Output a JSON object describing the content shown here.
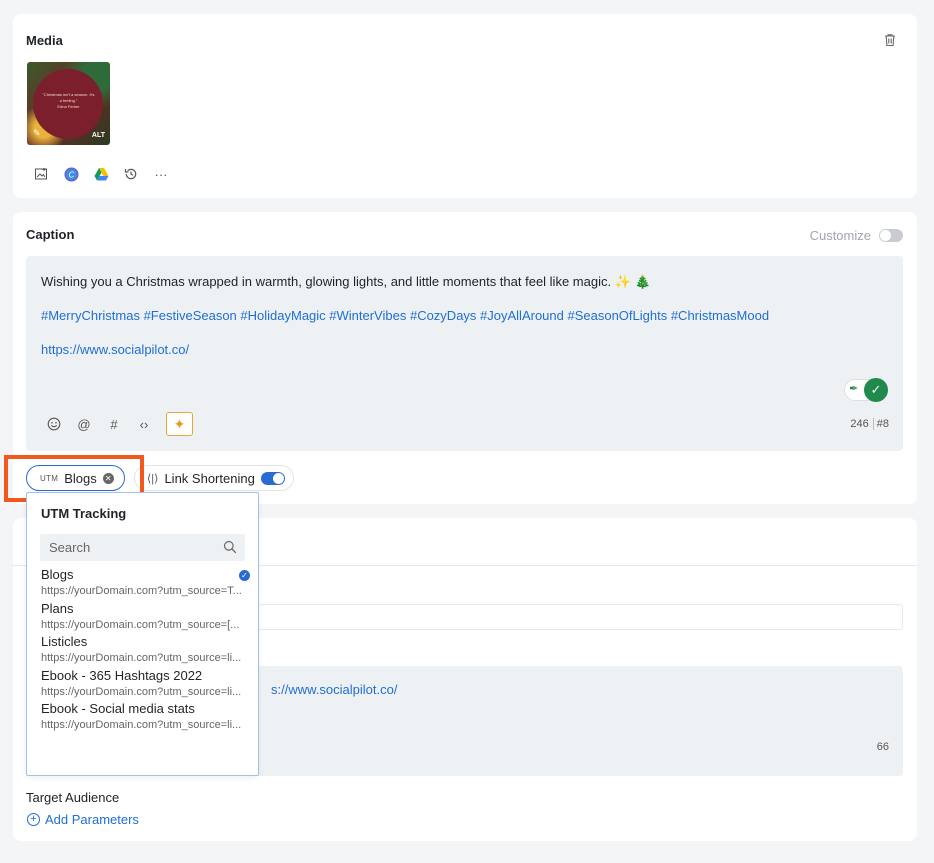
{
  "media": {
    "title": "Media",
    "thumbnail": {
      "quote": "\"Christmas isn't a season. It's a feeling.\"",
      "author": "Edna Ferber",
      "alt_badge": "ALT"
    },
    "tools": [
      "image-icon",
      "canva-icon",
      "drive-icon",
      "history-icon",
      "more-icon"
    ]
  },
  "caption": {
    "title": "Caption",
    "customize_label": "Customize",
    "text": "Wishing you a Christmas wrapped in warmth, glowing lights, and little moments that feel like magic. ✨ 🎄",
    "hashtags": "#MerryChristmas #FestiveSeason #HolidayMagic #WinterVibes #CozyDays #JoyAllAround #SeasonOfLights #ChristmasMood",
    "link": "https://www.socialpilot.co/",
    "char_count": "246",
    "hashtag_count": "#8"
  },
  "utm_chip": {
    "logo": "UTM",
    "label": "Blogs"
  },
  "link_shortening": {
    "label": "Link Shortening",
    "enabled": true
  },
  "utm_dropdown": {
    "title": "UTM Tracking",
    "search_placeholder": "Search",
    "items": [
      {
        "name": "Blogs",
        "url": "https://yourDomain.com?utm_source=T...",
        "selected": true
      },
      {
        "name": "Plans",
        "url": "https://yourDomain.com?utm_source=[...",
        "selected": false
      },
      {
        "name": "Listicles",
        "url": "https://yourDomain.com?utm_source=li...",
        "selected": false
      },
      {
        "name": "Ebook - 365 Hashtags 2022",
        "url": "https://yourDomain.com?utm_source=li...",
        "selected": false
      },
      {
        "name": "Ebook - Social media stats",
        "url": "https://yourDomain.com?utm_source=li...",
        "selected": false
      }
    ]
  },
  "bottom": {
    "link_partial": "s://www.socialpilot.co/",
    "char_count": "66",
    "target_audience_label": "Target Audience",
    "add_parameters_label": "Add Parameters"
  },
  "colors": {
    "accent": "#2a6bd3",
    "link": "#1f6fd1",
    "highlight": "#f2571c",
    "success": "#1f8a4c"
  }
}
